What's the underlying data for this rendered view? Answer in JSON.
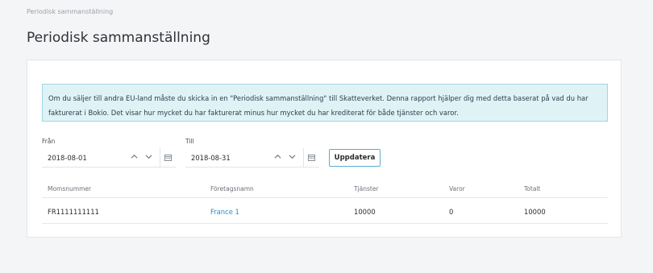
{
  "breadcrumb": "Periodisk sammanställning",
  "title": "Periodisk sammanställning",
  "info": "Om du säljer till andra EU-land måste du skicka in en \"Periodisk sammanställning\" till Skatteverket. Denna rapport hjälper dig med detta baserat på vad du har fakturerat i Bokio. Det visar hur mycket du har fakturerat minus hur mycket du har krediterat för både tjänster och varor.",
  "from": {
    "label": "Från",
    "value": "2018-08-01"
  },
  "to": {
    "label": "Till",
    "value": "2018-08-31"
  },
  "update_label": "Uppdatera",
  "table": {
    "headers": [
      "Momsnummer",
      "Företagsnamn",
      "Tjänster",
      "Varor",
      "Totalt"
    ],
    "rows": [
      [
        "FR1111111111",
        "France 1",
        "10000",
        "0",
        "10000"
      ]
    ]
  }
}
